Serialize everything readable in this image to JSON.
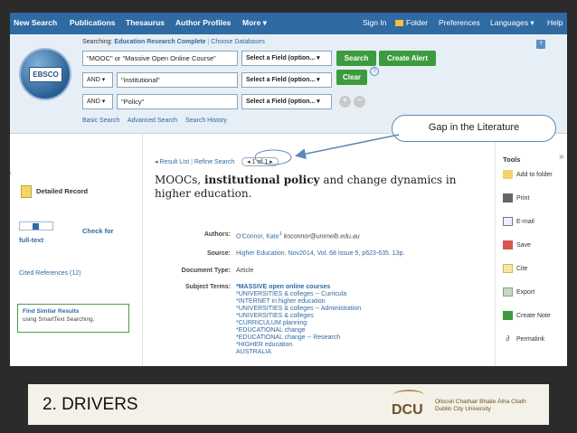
{
  "topnav": {
    "new_search": "New Search",
    "publications": "Publications",
    "thesaurus": "Thesaurus",
    "author_profiles": "Author Profiles",
    "more": "More ▾",
    "sign_in": "Sign In",
    "folder": "Folder",
    "preferences": "Preferences",
    "languages": "Languages ▾",
    "help": "Help"
  },
  "logo_text": "EBSCO",
  "search": {
    "searching_label": "Searching:",
    "database": "Education Research Complete",
    "choose_db": "Choose Databases",
    "row1_value": "\"MOOC\" or \"Massive Open Online Course\"",
    "row2_bool": "AND ▾",
    "row2_value": "\"institutional\"",
    "row3_bool": "AND ▾",
    "row3_value": "\"Policy\"",
    "field_select": "Select a Field (option... ▾",
    "search_btn": "Search",
    "create_alert_btn": "Create Alert",
    "clear_btn": "Clear",
    "help_q": "?",
    "plus": "+",
    "minus": "−"
  },
  "search_links": {
    "basic": "Basic Search",
    "advanced": "Advanced Search",
    "history": "Search History"
  },
  "callout": "Gap in the Literature",
  "left": {
    "detailed_record": "Detailed Record",
    "check_for": "Check for",
    "full_text": "full-text",
    "cited_refs": "Cited References (12)",
    "find_similar": "Find Similar Results",
    "find_similar_sub": "using SmartText Searching."
  },
  "result_nav": {
    "result_list": "◂ Result List",
    "refine": "Refine Search",
    "count": "◂ 1 of 1 ▸"
  },
  "record": {
    "title_a": "MOOCs,",
    "title_b": "institutional policy",
    "title_c": "and change dynamics in higher education.",
    "authors_label": "Authors:",
    "authors_value": "O'Connor, Kate",
    "authors_sup": "1",
    "authors_email": "koconnor@unimelb.edu.au",
    "source_label": "Source:",
    "source_value": "Higher Education. Nov2014, Vol. 68 Issue 5, p623-635. 13p.",
    "doctype_label": "Document Type:",
    "doctype_value": "Article",
    "subjects_label": "Subject Terms:",
    "subjects": [
      "*MASSIVE open online courses",
      "*UNIVERSITIES & colleges -- Curricula",
      "*INTERNET in higher education",
      "*UNIVERSITIES & colleges -- Administration",
      "*UNIVERSITIES & colleges",
      "*CURRICULUM planning",
      "*EDUCATIONAL change",
      "*EDUCATIONAL change -- Research",
      "*HIGHER education",
      "AUSTRALIA"
    ]
  },
  "tools": {
    "heading": "Tools",
    "items": [
      "Add to folder",
      "Print",
      "E-mail",
      "Save",
      "Cite",
      "Export",
      "Create Note",
      "Permalink"
    ]
  },
  "slide": {
    "heading": "2. DRIVERS",
    "dcu": "DCU",
    "uni_irish": "Ollscoil Chathair Bhaile Átha Cliath",
    "uni_english": "Dublin City University"
  }
}
